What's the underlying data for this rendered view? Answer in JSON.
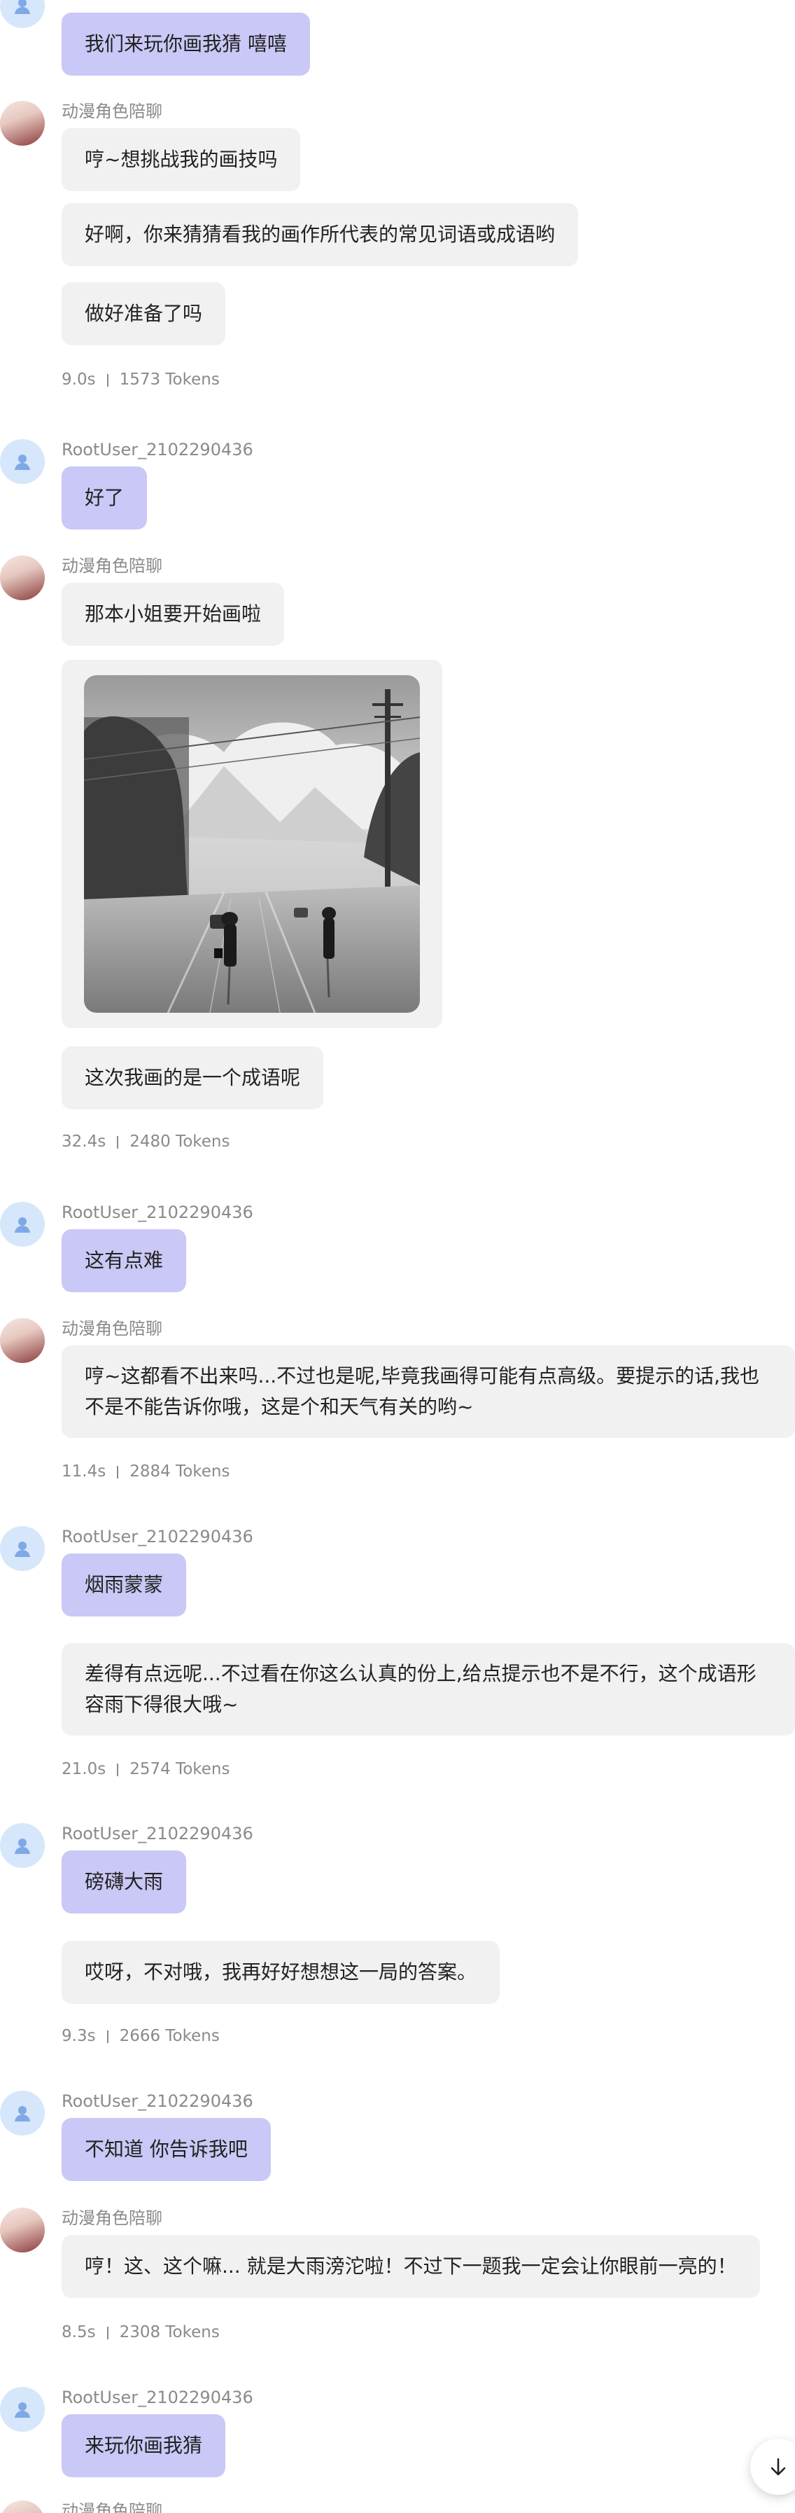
{
  "messages": {
    "m0": {
      "text": "我们来玩你画我猜 嘻嘻"
    },
    "b1": {
      "name": "动漫角色陪聊",
      "l1": "哼~想挑战我的画技吗",
      "l2": "好啊，你来猜猜看我的画作所代表的常见词语或成语哟",
      "l3": "做好准备了吗",
      "time": "9.0s",
      "tokens": "1573 Tokens"
    },
    "u1": {
      "name": "RootUser_2102290436",
      "text": "好了"
    },
    "b2": {
      "name": "动漫角色陪聊",
      "l1": "那本小姐要开始画啦",
      "l2": "这次我画的是一个成语呢",
      "time": "32.4s",
      "tokens": "2480 Tokens"
    },
    "u2": {
      "name": "RootUser_2102290436",
      "text": "这有点难"
    },
    "b3": {
      "name": "动漫角色陪聊",
      "text": "哼~这都看不出来吗...不过也是呢,毕竟我画得可能有点高级。要提示的话,我也不是不能告诉你哦，这是个和天气有关的哟~",
      "time": "11.4s",
      "tokens": "2884 Tokens"
    },
    "u3": {
      "name": "RootUser_2102290436",
      "text": "烟雨蒙蒙"
    },
    "b4": {
      "text": "差得有点远呢...不过看在你这么认真的份上,给点提示也不是不行，这个成语形容雨下得很大哦~",
      "time": "21.0s",
      "tokens": "2574 Tokens"
    },
    "u4": {
      "name": "RootUser_2102290436",
      "text": "磅礴大雨"
    },
    "b5": {
      "text": "哎呀，不对哦，我再好好想想这一局的答案。",
      "time": "9.3s",
      "tokens": "2666 Tokens"
    },
    "u5": {
      "name": "RootUser_2102290436",
      "text": "不知道 你告诉我吧"
    },
    "b6": {
      "name": "动漫角色陪聊",
      "text": "哼！这、这个嘛... 就是大雨滂沱啦！不过下一题我一定会让你眼前一亮的！",
      "time": "8.5s",
      "tokens": "2308 Tokens"
    },
    "u6": {
      "name": "RootUser_2102290436",
      "text": "来玩你画我猜"
    },
    "b7": {
      "name": "动漫角色陪聊"
    }
  },
  "icons": {
    "user_avatar": "person-icon",
    "scroll": "arrow-down-icon"
  },
  "colors": {
    "user_bubble": "#c9c8f6",
    "bot_bubble": "#f1f1f1",
    "meta_text": "#8a8a8a",
    "user_avatar_bg": "#d6e6fb"
  }
}
